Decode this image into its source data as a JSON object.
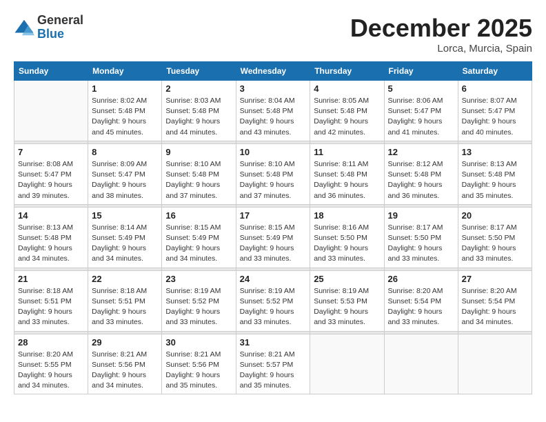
{
  "header": {
    "logo_general": "General",
    "logo_blue": "Blue",
    "month_title": "December 2025",
    "location": "Lorca, Murcia, Spain"
  },
  "weekdays": [
    "Sunday",
    "Monday",
    "Tuesday",
    "Wednesday",
    "Thursday",
    "Friday",
    "Saturday"
  ],
  "weeks": [
    [
      {
        "day": "",
        "sunrise": "",
        "sunset": "",
        "daylight": ""
      },
      {
        "day": "1",
        "sunrise": "Sunrise: 8:02 AM",
        "sunset": "Sunset: 5:48 PM",
        "daylight": "Daylight: 9 hours and 45 minutes."
      },
      {
        "day": "2",
        "sunrise": "Sunrise: 8:03 AM",
        "sunset": "Sunset: 5:48 PM",
        "daylight": "Daylight: 9 hours and 44 minutes."
      },
      {
        "day": "3",
        "sunrise": "Sunrise: 8:04 AM",
        "sunset": "Sunset: 5:48 PM",
        "daylight": "Daylight: 9 hours and 43 minutes."
      },
      {
        "day": "4",
        "sunrise": "Sunrise: 8:05 AM",
        "sunset": "Sunset: 5:48 PM",
        "daylight": "Daylight: 9 hours and 42 minutes."
      },
      {
        "day": "5",
        "sunrise": "Sunrise: 8:06 AM",
        "sunset": "Sunset: 5:47 PM",
        "daylight": "Daylight: 9 hours and 41 minutes."
      },
      {
        "day": "6",
        "sunrise": "Sunrise: 8:07 AM",
        "sunset": "Sunset: 5:47 PM",
        "daylight": "Daylight: 9 hours and 40 minutes."
      }
    ],
    [
      {
        "day": "7",
        "sunrise": "Sunrise: 8:08 AM",
        "sunset": "Sunset: 5:47 PM",
        "daylight": "Daylight: 9 hours and 39 minutes."
      },
      {
        "day": "8",
        "sunrise": "Sunrise: 8:09 AM",
        "sunset": "Sunset: 5:47 PM",
        "daylight": "Daylight: 9 hours and 38 minutes."
      },
      {
        "day": "9",
        "sunrise": "Sunrise: 8:10 AM",
        "sunset": "Sunset: 5:48 PM",
        "daylight": "Daylight: 9 hours and 37 minutes."
      },
      {
        "day": "10",
        "sunrise": "Sunrise: 8:10 AM",
        "sunset": "Sunset: 5:48 PM",
        "daylight": "Daylight: 9 hours and 37 minutes."
      },
      {
        "day": "11",
        "sunrise": "Sunrise: 8:11 AM",
        "sunset": "Sunset: 5:48 PM",
        "daylight": "Daylight: 9 hours and 36 minutes."
      },
      {
        "day": "12",
        "sunrise": "Sunrise: 8:12 AM",
        "sunset": "Sunset: 5:48 PM",
        "daylight": "Daylight: 9 hours and 36 minutes."
      },
      {
        "day": "13",
        "sunrise": "Sunrise: 8:13 AM",
        "sunset": "Sunset: 5:48 PM",
        "daylight": "Daylight: 9 hours and 35 minutes."
      }
    ],
    [
      {
        "day": "14",
        "sunrise": "Sunrise: 8:13 AM",
        "sunset": "Sunset: 5:48 PM",
        "daylight": "Daylight: 9 hours and 34 minutes."
      },
      {
        "day": "15",
        "sunrise": "Sunrise: 8:14 AM",
        "sunset": "Sunset: 5:49 PM",
        "daylight": "Daylight: 9 hours and 34 minutes."
      },
      {
        "day": "16",
        "sunrise": "Sunrise: 8:15 AM",
        "sunset": "Sunset: 5:49 PM",
        "daylight": "Daylight: 9 hours and 34 minutes."
      },
      {
        "day": "17",
        "sunrise": "Sunrise: 8:15 AM",
        "sunset": "Sunset: 5:49 PM",
        "daylight": "Daylight: 9 hours and 33 minutes."
      },
      {
        "day": "18",
        "sunrise": "Sunrise: 8:16 AM",
        "sunset": "Sunset: 5:50 PM",
        "daylight": "Daylight: 9 hours and 33 minutes."
      },
      {
        "day": "19",
        "sunrise": "Sunrise: 8:17 AM",
        "sunset": "Sunset: 5:50 PM",
        "daylight": "Daylight: 9 hours and 33 minutes."
      },
      {
        "day": "20",
        "sunrise": "Sunrise: 8:17 AM",
        "sunset": "Sunset: 5:50 PM",
        "daylight": "Daylight: 9 hours and 33 minutes."
      }
    ],
    [
      {
        "day": "21",
        "sunrise": "Sunrise: 8:18 AM",
        "sunset": "Sunset: 5:51 PM",
        "daylight": "Daylight: 9 hours and 33 minutes."
      },
      {
        "day": "22",
        "sunrise": "Sunrise: 8:18 AM",
        "sunset": "Sunset: 5:51 PM",
        "daylight": "Daylight: 9 hours and 33 minutes."
      },
      {
        "day": "23",
        "sunrise": "Sunrise: 8:19 AM",
        "sunset": "Sunset: 5:52 PM",
        "daylight": "Daylight: 9 hours and 33 minutes."
      },
      {
        "day": "24",
        "sunrise": "Sunrise: 8:19 AM",
        "sunset": "Sunset: 5:52 PM",
        "daylight": "Daylight: 9 hours and 33 minutes."
      },
      {
        "day": "25",
        "sunrise": "Sunrise: 8:19 AM",
        "sunset": "Sunset: 5:53 PM",
        "daylight": "Daylight: 9 hours and 33 minutes."
      },
      {
        "day": "26",
        "sunrise": "Sunrise: 8:20 AM",
        "sunset": "Sunset: 5:54 PM",
        "daylight": "Daylight: 9 hours and 33 minutes."
      },
      {
        "day": "27",
        "sunrise": "Sunrise: 8:20 AM",
        "sunset": "Sunset: 5:54 PM",
        "daylight": "Daylight: 9 hours and 34 minutes."
      }
    ],
    [
      {
        "day": "28",
        "sunrise": "Sunrise: 8:20 AM",
        "sunset": "Sunset: 5:55 PM",
        "daylight": "Daylight: 9 hours and 34 minutes."
      },
      {
        "day": "29",
        "sunrise": "Sunrise: 8:21 AM",
        "sunset": "Sunset: 5:56 PM",
        "daylight": "Daylight: 9 hours and 34 minutes."
      },
      {
        "day": "30",
        "sunrise": "Sunrise: 8:21 AM",
        "sunset": "Sunset: 5:56 PM",
        "daylight": "Daylight: 9 hours and 35 minutes."
      },
      {
        "day": "31",
        "sunrise": "Sunrise: 8:21 AM",
        "sunset": "Sunset: 5:57 PM",
        "daylight": "Daylight: 9 hours and 35 minutes."
      },
      {
        "day": "",
        "sunrise": "",
        "sunset": "",
        "daylight": ""
      },
      {
        "day": "",
        "sunrise": "",
        "sunset": "",
        "daylight": ""
      },
      {
        "day": "",
        "sunrise": "",
        "sunset": "",
        "daylight": ""
      }
    ]
  ]
}
